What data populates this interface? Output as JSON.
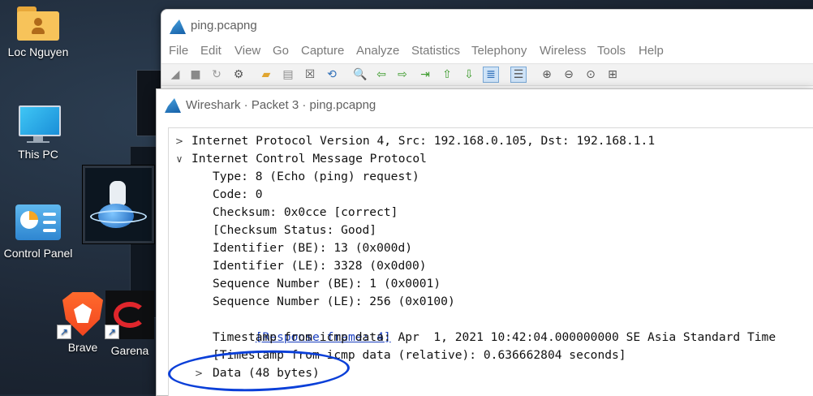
{
  "desktop": {
    "icons": [
      {
        "label": "Loc Nguyen"
      },
      {
        "label": "This PC"
      },
      {
        "label": "Control Panel"
      },
      {
        "label": "Brave"
      },
      {
        "label": "Garena"
      }
    ]
  },
  "main_window": {
    "title": "ping.pcapng",
    "menu": [
      "File",
      "Edit",
      "View",
      "Go",
      "Capture",
      "Analyze",
      "Statistics",
      "Telephony",
      "Wireless",
      "Tools",
      "Help"
    ]
  },
  "dialog": {
    "title": "Wireshark · Packet 3 · ping.pcapng",
    "tree": {
      "ip": {
        "label": "Internet Protocol Version 4, Src: 192.168.0.105, Dst: 192.168.1.1",
        "expanded": false
      },
      "icmp": {
        "label": "Internet Control Message Protocol",
        "expanded": true
      },
      "fields": {
        "type": "Type: 8 (Echo (ping) request)",
        "code": "Code: 0",
        "checksum": "Checksum: 0x0cce [correct]",
        "checksum_status": "[Checksum Status: Good]",
        "id_be": "Identifier (BE): 13 (0x000d)",
        "id_le": "Identifier (LE): 3328 (0x0d00)",
        "seq_be": "Sequence Number (BE): 1 (0x0001)",
        "seq_le": "Sequence Number (LE): 256 (0x0100)",
        "response_frame": "[Response frame: 4]",
        "timestamp": "Timestamp from icmp data: Apr  1, 2021 10:42:04.000000000 SE Asia Standard Time",
        "timestamp_rel": "[Timestamp from icmp data (relative): 0.636662804 seconds]",
        "data": "Data (48 bytes)"
      }
    }
  },
  "annotation": {
    "color": "#0a3fd8"
  }
}
